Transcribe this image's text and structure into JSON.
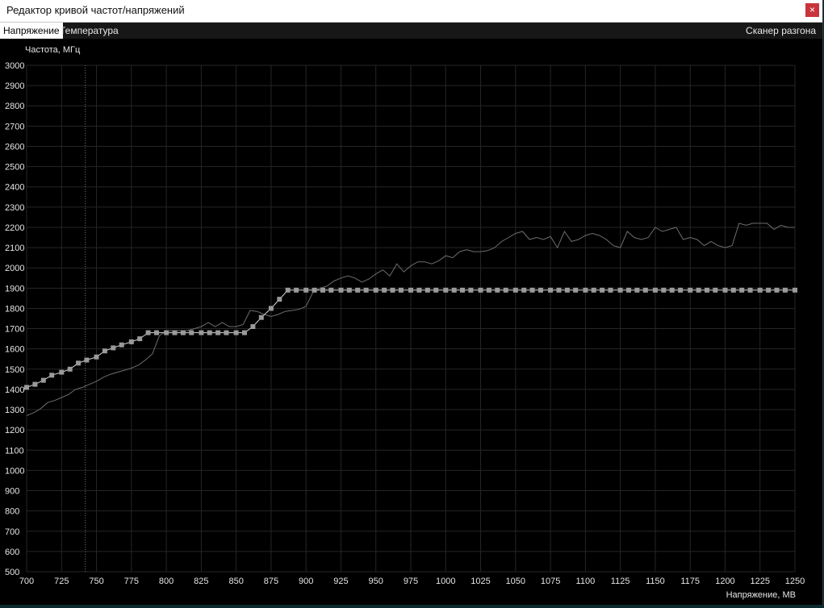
{
  "window": {
    "title": "Редактор кривой частот/напряжений",
    "close_glyph": "×"
  },
  "tabs": [
    {
      "label": "Напряжение",
      "active": true
    },
    {
      "label": "Температура",
      "active": false
    }
  ],
  "scanner_label": "Сканер разгона",
  "colors": {
    "background": "#000000",
    "grid": "#262626",
    "curve": "#d8d8d8",
    "point": "#9a9a9a",
    "measured_line": "#6e6e6e",
    "marker_line": "#777777",
    "close_button": "#c8343c"
  },
  "chart_data": {
    "type": "line",
    "ylabel": "Частота, МГц",
    "xlabel": "Напряжение, МВ",
    "xlim": [
      700,
      1250
    ],
    "ylim": [
      500,
      3000
    ],
    "x_ticks": [
      700,
      725,
      750,
      775,
      800,
      825,
      850,
      875,
      900,
      925,
      950,
      975,
      1000,
      1025,
      1050,
      1075,
      1100,
      1125,
      1150,
      1175,
      1200,
      1225,
      1250
    ],
    "y_ticks": [
      500,
      600,
      700,
      800,
      900,
      1000,
      1100,
      1200,
      1300,
      1400,
      1500,
      1600,
      1700,
      1800,
      1900,
      2000,
      2100,
      2200,
      2300,
      2400,
      2500,
      2600,
      2700,
      2800,
      2900,
      3000
    ],
    "grid": true,
    "marker_x": 742,
    "series": [
      {
        "role": "vf-curve",
        "x": [
          700,
          706,
          712,
          718,
          725,
          731,
          737,
          743,
          750,
          756,
          762,
          768,
          775,
          781,
          787,
          793,
          800,
          806,
          812,
          818,
          825,
          831,
          837,
          843,
          850,
          856,
          862,
          868,
          875,
          881,
          887,
          893,
          900,
          906,
          912,
          918,
          925,
          931,
          937,
          943,
          950,
          956,
          962,
          968,
          975,
          981,
          987,
          993,
          1000,
          1006,
          1012,
          1018,
          1025,
          1031,
          1037,
          1043,
          1050,
          1056,
          1062,
          1068,
          1075,
          1081,
          1087,
          1093,
          1100,
          1106,
          1112,
          1118,
          1125,
          1131,
          1137,
          1143,
          1150,
          1156,
          1162,
          1168,
          1175,
          1181,
          1187,
          1193,
          1200,
          1206,
          1212,
          1218,
          1225,
          1231,
          1237,
          1243,
          1250
        ],
        "y": [
          1410,
          1425,
          1445,
          1470,
          1485,
          1500,
          1530,
          1545,
          1560,
          1590,
          1605,
          1620,
          1635,
          1650,
          1680,
          1680,
          1680,
          1680,
          1680,
          1680,
          1680,
          1680,
          1680,
          1680,
          1680,
          1680,
          1710,
          1755,
          1800,
          1845,
          1890,
          1890,
          1890,
          1890,
          1890,
          1890,
          1890,
          1890,
          1890,
          1890,
          1890,
          1890,
          1890,
          1890,
          1890,
          1890,
          1890,
          1890,
          1890,
          1890,
          1890,
          1890,
          1890,
          1890,
          1890,
          1890,
          1890,
          1890,
          1890,
          1890,
          1890,
          1890,
          1890,
          1890,
          1890,
          1890,
          1890,
          1890,
          1890,
          1890,
          1890,
          1890,
          1890,
          1890,
          1890,
          1890,
          1890,
          1890,
          1890,
          1890,
          1890,
          1890,
          1890,
          1890,
          1890,
          1890,
          1890,
          1890,
          1890
        ]
      },
      {
        "role": "measured",
        "x": [
          700,
          705,
          710,
          715,
          720,
          725,
          730,
          735,
          740,
          745,
          750,
          755,
          760,
          765,
          770,
          775,
          780,
          785,
          790,
          795,
          800,
          805,
          810,
          815,
          820,
          825,
          830,
          835,
          840,
          845,
          850,
          855,
          860,
          865,
          870,
          875,
          880,
          885,
          890,
          895,
          900,
          905,
          910,
          915,
          920,
          925,
          930,
          935,
          940,
          945,
          950,
          955,
          960,
          965,
          970,
          975,
          980,
          985,
          990,
          995,
          1000,
          1005,
          1010,
          1015,
          1020,
          1025,
          1030,
          1035,
          1040,
          1045,
          1050,
          1055,
          1060,
          1065,
          1070,
          1075,
          1080,
          1085,
          1090,
          1095,
          1100,
          1105,
          1110,
          1115,
          1120,
          1125,
          1130,
          1135,
          1140,
          1145,
          1150,
          1155,
          1160,
          1165,
          1170,
          1175,
          1180,
          1185,
          1190,
          1195,
          1200,
          1205,
          1210,
          1215,
          1220,
          1225,
          1230,
          1235,
          1240,
          1245,
          1250
        ],
        "y": [
          1270,
          1285,
          1305,
          1335,
          1345,
          1360,
          1375,
          1400,
          1410,
          1425,
          1440,
          1460,
          1475,
          1485,
          1495,
          1505,
          1520,
          1545,
          1575,
          1665,
          1690,
          1690,
          1690,
          1690,
          1700,
          1710,
          1730,
          1710,
          1730,
          1710,
          1710,
          1720,
          1790,
          1785,
          1770,
          1760,
          1770,
          1785,
          1790,
          1795,
          1810,
          1880,
          1900,
          1910,
          1935,
          1950,
          1960,
          1950,
          1930,
          1945,
          1970,
          1990,
          1960,
          2020,
          1980,
          2010,
          2030,
          2030,
          2020,
          2035,
          2060,
          2050,
          2080,
          2090,
          2080,
          2080,
          2085,
          2100,
          2130,
          2150,
          2170,
          2180,
          2140,
          2150,
          2140,
          2155,
          2100,
          2180,
          2130,
          2140,
          2160,
          2170,
          2160,
          2140,
          2110,
          2100,
          2180,
          2150,
          2140,
          2150,
          2200,
          2180,
          2190,
          2200,
          2140,
          2150,
          2140,
          2110,
          2130,
          2110,
          2100,
          2110,
          2220,
          2210,
          2220,
          2220,
          2220,
          2190,
          2210,
          2200,
          2200
        ]
      }
    ]
  }
}
